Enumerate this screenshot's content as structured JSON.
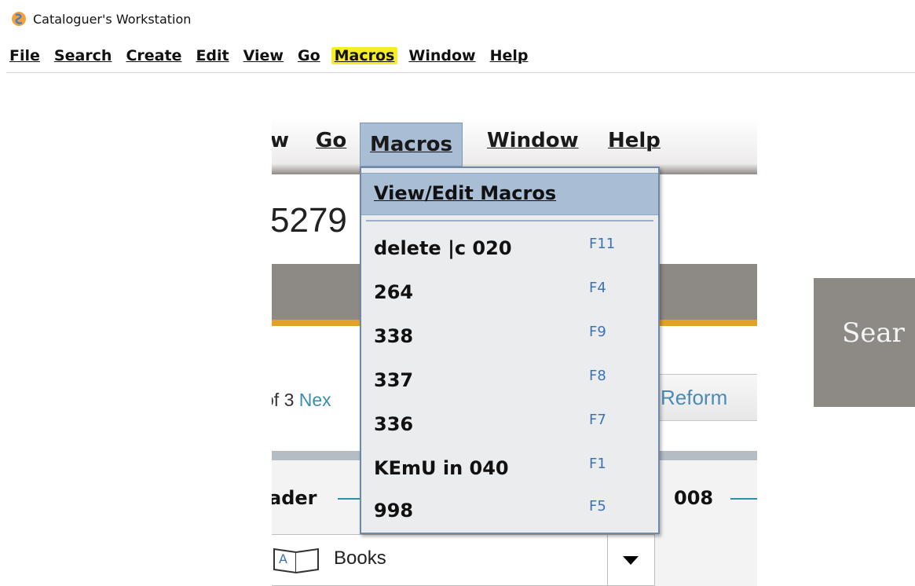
{
  "app": {
    "title": "Cataloguer's Workstation"
  },
  "menubar": {
    "items": [
      "File",
      "Search",
      "Create",
      "Edit",
      "View",
      "Go",
      "Macros",
      "Window",
      "Help"
    ],
    "highlighted": "Macros",
    "highlight_color": "#f4ee22"
  },
  "inset": {
    "menubar": {
      "partial": "w",
      "go": "Go",
      "macros": "Macros",
      "window": "Window",
      "help": "Help"
    },
    "record_number": "5279",
    "pager": {
      "prefix": "of 3",
      "next": "Nex"
    },
    "reformat_label": "Reform",
    "leader_label": "ader",
    "field_008_label": "008",
    "record_type": "Books",
    "dropdown": {
      "header": "View/Edit Macros",
      "items": [
        {
          "label": "delete |c 020",
          "key": "F11"
        },
        {
          "label": "264",
          "key": "F4"
        },
        {
          "label": "338",
          "key": "F9"
        },
        {
          "label": "337",
          "key": "F8"
        },
        {
          "label": "336",
          "key": "F7"
        },
        {
          "label": "KEmU in 040",
          "key": "F1"
        },
        {
          "label": "998",
          "key": "F5"
        }
      ]
    }
  },
  "side": {
    "search_text": "Sear"
  },
  "colors": {
    "menu_active": "#a9bdd4",
    "accent_orange": "#e3a223",
    "panel_grey": "#8d8985",
    "shortcut_blue": "#3b73b5"
  }
}
